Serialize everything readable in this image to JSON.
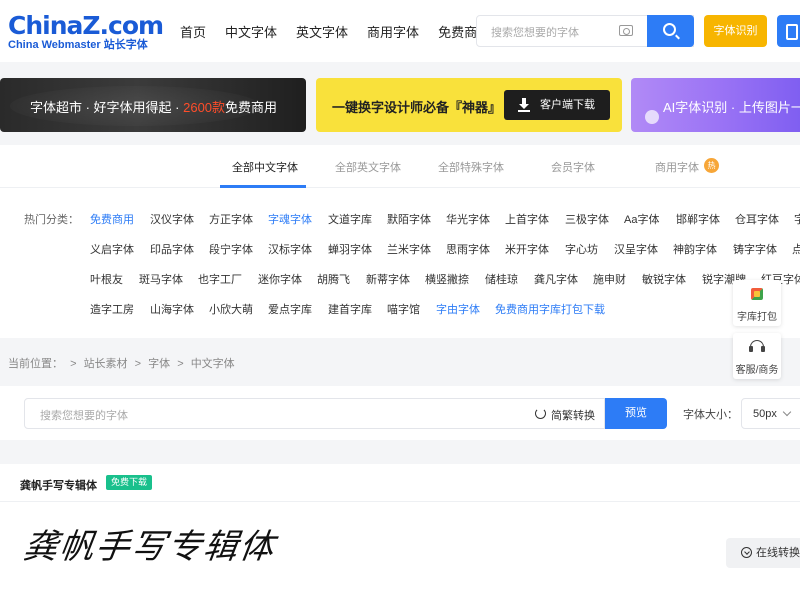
{
  "header": {
    "logo_main": "ChinaZ.com",
    "logo_sub": "China Webmaster 站长字体",
    "nav": [
      "首页",
      "中文字体",
      "英文字体",
      "商用字体",
      "免费商用"
    ],
    "search_placeholder": "搜索您想要的字体",
    "identify_label": "字体识别"
  },
  "banners": {
    "b1_prefix": "字体超市 · 好字体用得起 · ",
    "b1_highlight": "2600款",
    "b1_suffix": "免费商用",
    "b2_text": "一键换字设计师必备『神器』",
    "b2_button": "客户端下载",
    "b3_text": "AI字体识别 · 上传图片一"
  },
  "tabs": [
    "全部中文字体",
    "全部英文字体",
    "全部特殊字体",
    "会员字体",
    "商用字体"
  ],
  "hot_badge": "热",
  "hot_label": "热门分类：",
  "categories": {
    "row1": [
      "免费商用",
      "汉仪字体",
      "方正字体",
      "字魂字体",
      "文道字库",
      "默陌字体",
      "华光字体",
      "上首字体",
      "三极字体",
      "Aa字体",
      "邯郸字体",
      "仓耳字体",
      "字"
    ],
    "row2": [
      "义启字体",
      "印品字体",
      "段宁字体",
      "汉标字体",
      "蝉羽字体",
      "兰米字体",
      "思雨字体",
      "米开字体",
      "字心坊",
      "汉呈字体",
      "神韵字体",
      "铸字字体",
      "点"
    ],
    "row3": [
      "叶根友",
      "斑马字体",
      "也字工厂",
      "迷你字体",
      "胡腾飞",
      "新蒂字体",
      "横竖撇捺",
      "储桂琼",
      "龚凡字体",
      "施申财",
      "敏锐字体",
      "锐字潮牌",
      "红豆字体"
    ],
    "row4": [
      "造字工房",
      "山海字体",
      "小欣大萌",
      "爱点字库",
      "建首字库",
      "喵字馆",
      "字由字体",
      "免费商用字库打包下载"
    ]
  },
  "side": {
    "pack": "字库打包",
    "service": "客服/商务"
  },
  "breadcrumb": [
    "当前位置：",
    ">",
    "站长素材",
    ">",
    "字体",
    ">",
    "中文字体"
  ],
  "toolbar": {
    "placeholder": "搜索您想要的字体",
    "convert": "简繁转换",
    "preview": "预览",
    "size_label": "字体大小：",
    "size_value": "50px"
  },
  "font": {
    "title": "龚帆手写专辑体",
    "badge": "免费下载",
    "sample": "龚帆手写专辑体",
    "online_convert": "在线转换"
  }
}
